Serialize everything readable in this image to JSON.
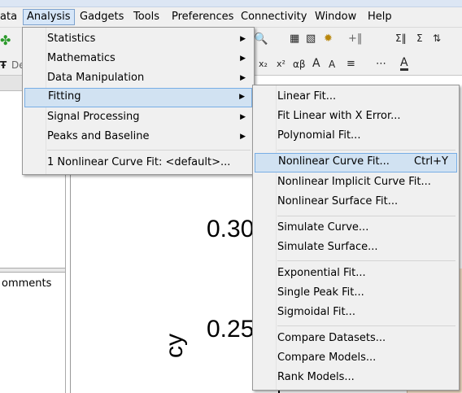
{
  "menubar": {
    "items": [
      "ata",
      "Analysis",
      "Gadgets",
      "Tools",
      "Preferences",
      "Connectivity",
      "Window",
      "Help"
    ]
  },
  "toolbar": {
    "font_box_text": "De",
    "icons": [
      "sum-icon",
      "sigma-icon",
      "sort-icon",
      "subscript-icon",
      "superscript-icon",
      "alpha-beta-icon",
      "increase-font-icon",
      "decrease-font-icon",
      "align-icon",
      "font-color-icon"
    ]
  },
  "left_panel": {
    "comments_label": "omments"
  },
  "graph": {
    "tick1": "0.30",
    "tick2": "0.25",
    "ylabel": "cy"
  },
  "analysis_menu": [
    {
      "label": "Statistics",
      "submenu": true
    },
    {
      "label": "Mathematics",
      "submenu": true
    },
    {
      "label": "Data Manipulation",
      "submenu": true
    },
    {
      "label": "Fitting",
      "submenu": true,
      "highlighted": true
    },
    {
      "label": "Signal Processing",
      "submenu": true
    },
    {
      "label": "Peaks and Baseline",
      "submenu": true
    },
    {
      "label": "1 Nonlinear Curve Fit: <default>...",
      "submenu": false
    }
  ],
  "fitting_menu": [
    {
      "label": "Linear Fit..."
    },
    {
      "label": "Fit Linear with X Error..."
    },
    {
      "label": "Polynomial Fit..."
    },
    {
      "label": "Nonlinear Curve Fit...",
      "shortcut": "Ctrl+Y",
      "highlighted": true
    },
    {
      "label": "Nonlinear Implicit Curve Fit..."
    },
    {
      "label": "Nonlinear Surface Fit..."
    },
    {
      "label": "Simulate Curve..."
    },
    {
      "label": "Simulate Surface..."
    },
    {
      "label": "Exponential Fit..."
    },
    {
      "label": "Single Peak Fit..."
    },
    {
      "label": "Sigmoidal Fit..."
    },
    {
      "label": "Compare Datasets..."
    },
    {
      "label": "Compare Models..."
    },
    {
      "label": "Rank Models..."
    }
  ]
}
